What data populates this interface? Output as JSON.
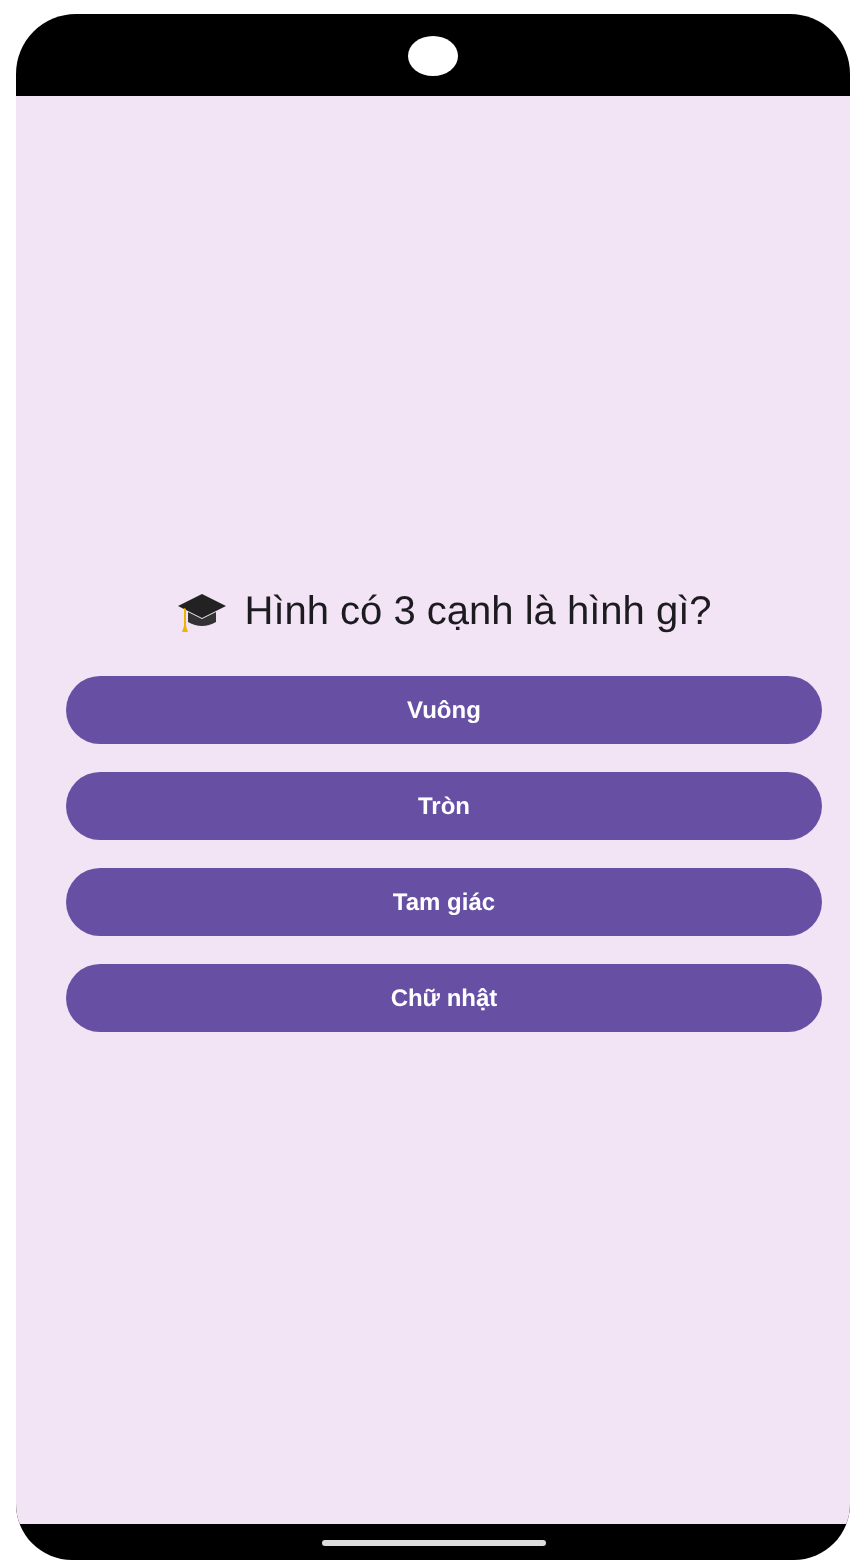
{
  "question": {
    "text": "Hình có 3 cạnh là hình gì?"
  },
  "answers": [
    {
      "label": "Vuông"
    },
    {
      "label": "Tròn"
    },
    {
      "label": "Tam giác"
    },
    {
      "label": "Chữ nhật"
    }
  ]
}
